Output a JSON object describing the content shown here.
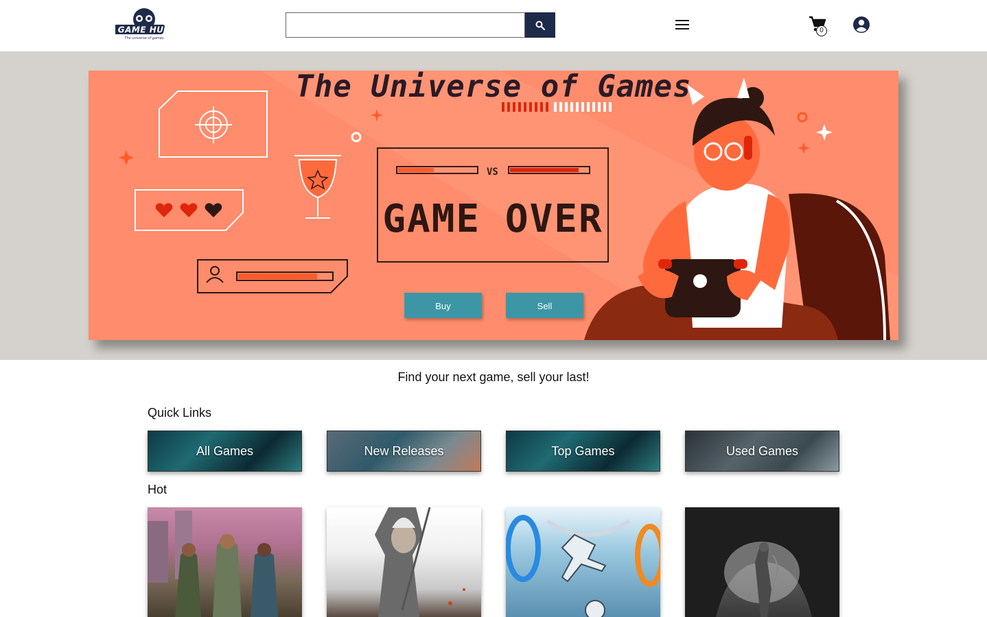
{
  "header": {
    "logo_text": "GAME HUB",
    "logo_tagline": "The universe of games",
    "search": {
      "placeholder": "",
      "value": ""
    },
    "search_button_icon": "search-icon",
    "menu_icon": "hamburger-menu-icon",
    "cart": {
      "icon": "shopping-cart-icon",
      "count": "0"
    },
    "account_icon": "account-circle-icon"
  },
  "hero": {
    "title": "The Universe of Games",
    "versus_label": "VS",
    "screen_text": "GAME OVER",
    "buy_label": "Buy",
    "sell_label": "Sell"
  },
  "tagline": "Find your next game, sell your last!",
  "quick_links": {
    "heading": "Quick Links",
    "items": [
      {
        "label": "All Games"
      },
      {
        "label": "New Releases"
      },
      {
        "label": "Top Games"
      },
      {
        "label": "Used Games"
      }
    ]
  },
  "hot": {
    "heading": "Hot"
  },
  "colors": {
    "hero_background": "#ff8c6c",
    "hero_band": "#d5d1cc",
    "button": "#3d96a6",
    "search_button": "#1e2a4a"
  }
}
